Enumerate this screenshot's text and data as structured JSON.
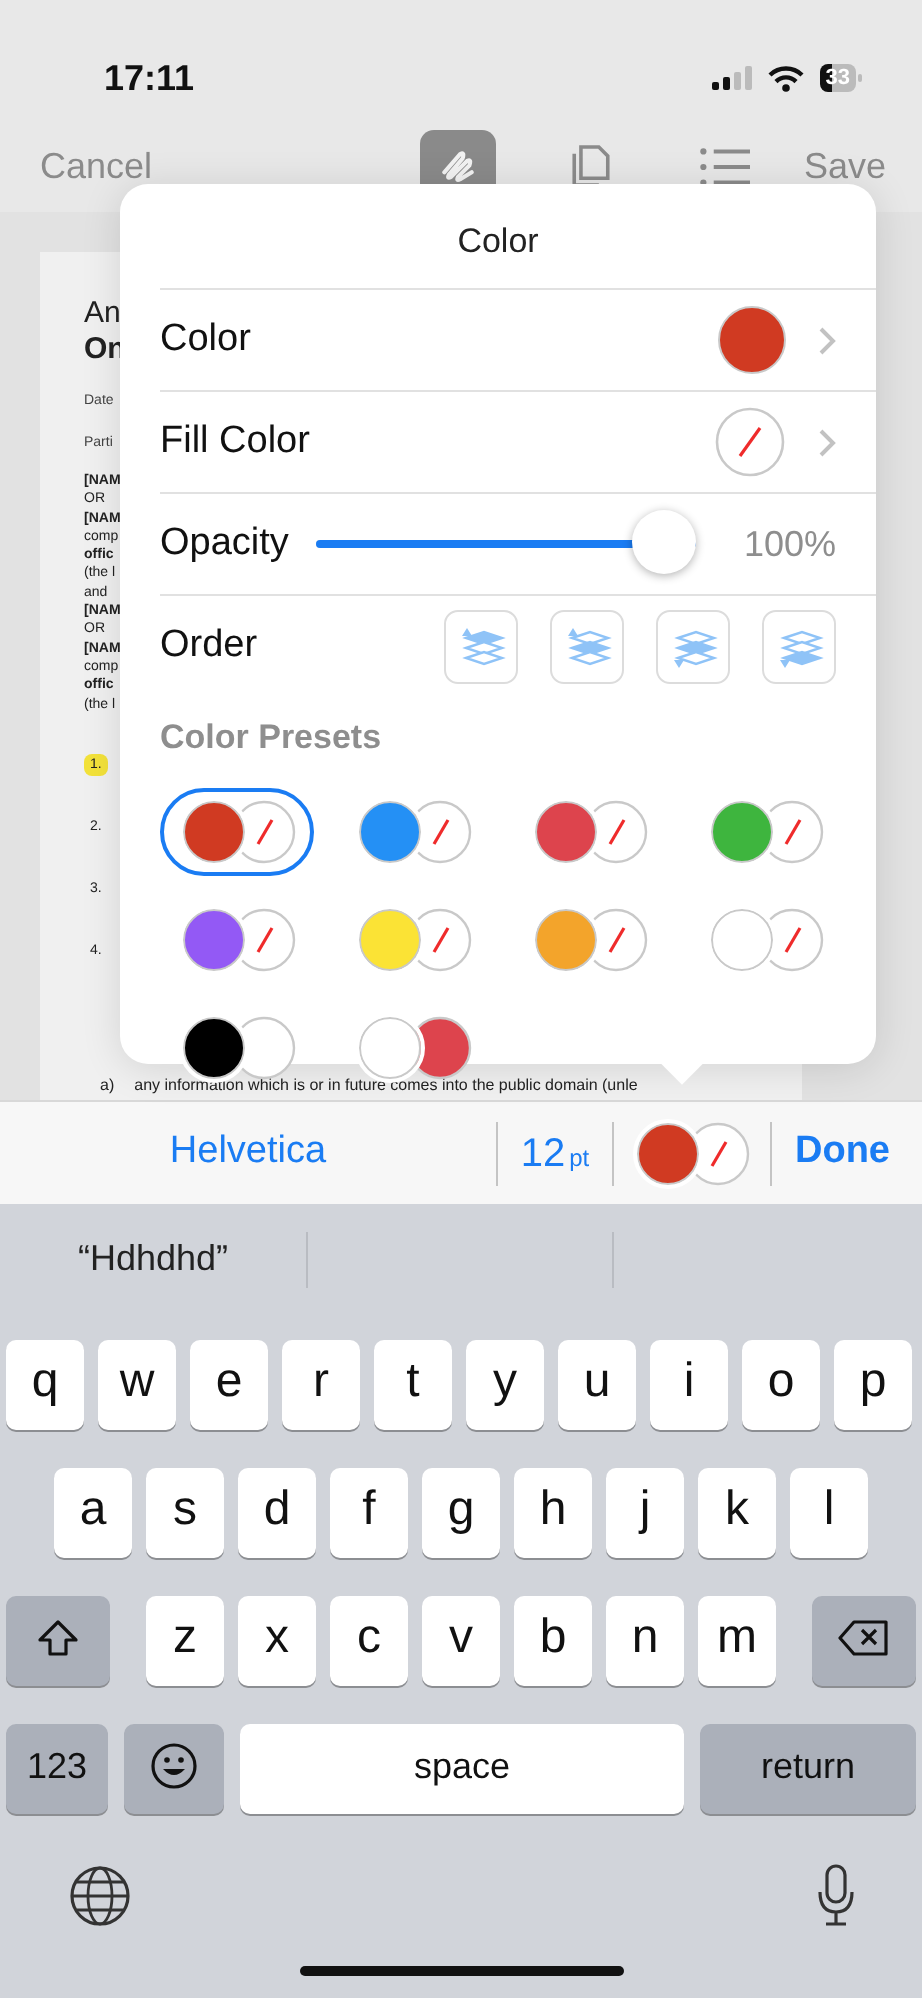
{
  "status_bar": {
    "time": "17:11",
    "battery": "33"
  },
  "nav": {
    "cancel": "Cancel",
    "save": "Save",
    "tools": [
      {
        "kind": "pen",
        "selected": true
      },
      {
        "kind": "copy",
        "selected": false
      },
      {
        "kind": "list",
        "selected": false
      }
    ]
  },
  "document": {
    "lines": [
      {
        "kind": "title",
        "text": "An"
      },
      {
        "kind": "title-bold",
        "text": "On"
      },
      {
        "kind": "small",
        "text": "Date"
      },
      {
        "kind": "small",
        "text": "Parti"
      },
      {
        "kind": "bold",
        "text": "[NAM"
      },
      {
        "kind": "text",
        "text": "OR"
      },
      {
        "kind": "bold",
        "text": "[NAM"
      },
      {
        "kind": "text",
        "text": "comp"
      },
      {
        "kind": "bold",
        "text": "offic"
      },
      {
        "kind": "text",
        "text": "(the l"
      },
      {
        "kind": "text",
        "text": "and"
      },
      {
        "kind": "bold",
        "text": "[NAM"
      },
      {
        "kind": "text",
        "text": "OR"
      },
      {
        "kind": "bold",
        "text": "[NAM"
      },
      {
        "kind": "text",
        "text": "comp"
      },
      {
        "kind": "bold",
        "text": "offic"
      },
      {
        "kind": "text",
        "text": "(the l"
      },
      {
        "kind": "item",
        "text": "1.",
        "highlighted": true
      },
      {
        "kind": "item",
        "text": "2.",
        "highlighted": false
      },
      {
        "kind": "item",
        "text": "3.",
        "highlighted": false
      },
      {
        "kind": "item",
        "text": "4.",
        "highlighted": false
      }
    ],
    "footer_marker": "a)",
    "footer_text": "any information which is or in future comes into the public domain (unle"
  },
  "popover": {
    "title": "Color",
    "rows": [
      {
        "kind": "color",
        "label": "Color",
        "color": "#d03a22"
      },
      {
        "kind": "fill",
        "label": "Fill Color"
      },
      {
        "kind": "slider",
        "label": "Opacity",
        "level": 1,
        "reading": "100%"
      },
      {
        "kind": "order",
        "label": "Order"
      }
    ],
    "presets_label": "Color Presets",
    "presets": [
      {
        "color": "#d03a22",
        "selected": true
      },
      {
        "color": "#2490f5",
        "selected": false
      },
      {
        "color": "#dd444d",
        "selected": false
      },
      {
        "color": "#3eb53e",
        "selected": false
      },
      {
        "color": "#9359f5",
        "selected": false
      },
      {
        "color": "#fbe335",
        "selected": false
      },
      {
        "color": "#f3a42b",
        "selected": false
      },
      {
        "color": "#ffffff",
        "selected": false
      },
      {
        "color": "#000000",
        "fill": {
          "color": "#ffffff"
        },
        "selected": false
      },
      {
        "color": "#ffffff",
        "fill": {
          "color": "#dd444d"
        },
        "selected": false
      }
    ]
  },
  "toolbar": {
    "font": "Helvetica",
    "size": "12",
    "unit": "pt",
    "color": "#d03a22",
    "done": "Done"
  },
  "keyboard": {
    "suggestions": [
      "“Hdhdhd”"
    ],
    "rows": [
      {
        "keys": [
          {
            "kind": "letter",
            "label": "q"
          },
          {
            "kind": "letter",
            "label": "w"
          },
          {
            "kind": "letter",
            "label": "e"
          },
          {
            "kind": "letter",
            "label": "r"
          },
          {
            "kind": "letter",
            "label": "t"
          },
          {
            "kind": "letter",
            "label": "y"
          },
          {
            "kind": "letter",
            "label": "u"
          },
          {
            "kind": "letter",
            "label": "i"
          },
          {
            "kind": "letter",
            "label": "o"
          },
          {
            "kind": "letter",
            "label": "p"
          }
        ]
      },
      {
        "keys": [
          {
            "kind": "letter",
            "label": "a"
          },
          {
            "kind": "letter",
            "label": "s"
          },
          {
            "kind": "letter",
            "label": "d"
          },
          {
            "kind": "letter",
            "label": "f"
          },
          {
            "kind": "letter",
            "label": "g"
          },
          {
            "kind": "letter",
            "label": "h"
          },
          {
            "kind": "letter",
            "label": "j"
          },
          {
            "kind": "letter",
            "label": "k"
          },
          {
            "kind": "letter",
            "label": "l"
          }
        ]
      },
      {
        "keys": [
          {
            "kind": "shift"
          },
          {
            "kind": "letter",
            "label": "z"
          },
          {
            "kind": "letter",
            "label": "x"
          },
          {
            "kind": "letter",
            "label": "c"
          },
          {
            "kind": "letter",
            "label": "v"
          },
          {
            "kind": "letter",
            "label": "b"
          },
          {
            "kind": "letter",
            "label": "n"
          },
          {
            "kind": "letter",
            "label": "m"
          },
          {
            "kind": "delete"
          }
        ]
      },
      {
        "keys": [
          {
            "kind": "mode",
            "label": "123"
          },
          {
            "kind": "emoji"
          },
          {
            "kind": "space",
            "label": "space"
          },
          {
            "kind": "return",
            "label": "return"
          }
        ]
      }
    ]
  }
}
